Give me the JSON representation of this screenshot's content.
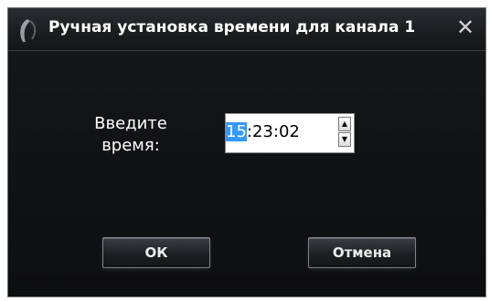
{
  "window": {
    "title": "Ручная установка времени для канала 1",
    "close_glyph": "✕"
  },
  "form": {
    "label": "Введите время:",
    "time": {
      "hours": "15",
      "rest": ":23:02"
    }
  },
  "buttons": {
    "ok": "ОК",
    "cancel": "Отмена"
  },
  "icons": {
    "logo": "app-logo-icon",
    "close": "close-icon",
    "spin_up": "arrow-up-icon",
    "spin_down": "arrow-down-icon"
  },
  "colors": {
    "dialog_bg": "#101214",
    "selection": "#3399ff",
    "text": "#ffffff"
  }
}
